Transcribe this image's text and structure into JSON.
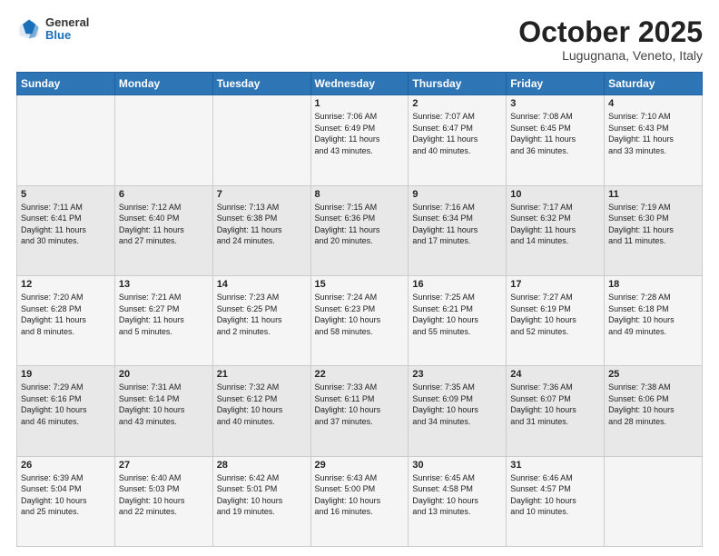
{
  "header": {
    "logo": {
      "general": "General",
      "blue": "Blue"
    },
    "title": "October 2025",
    "subtitle": "Lugugnana, Veneto, Italy"
  },
  "days_of_week": [
    "Sunday",
    "Monday",
    "Tuesday",
    "Wednesday",
    "Thursday",
    "Friday",
    "Saturday"
  ],
  "weeks": [
    [
      {
        "day": "",
        "info": ""
      },
      {
        "day": "",
        "info": ""
      },
      {
        "day": "",
        "info": ""
      },
      {
        "day": "1",
        "info": "Sunrise: 7:06 AM\nSunset: 6:49 PM\nDaylight: 11 hours\nand 43 minutes."
      },
      {
        "day": "2",
        "info": "Sunrise: 7:07 AM\nSunset: 6:47 PM\nDaylight: 11 hours\nand 40 minutes."
      },
      {
        "day": "3",
        "info": "Sunrise: 7:08 AM\nSunset: 6:45 PM\nDaylight: 11 hours\nand 36 minutes."
      },
      {
        "day": "4",
        "info": "Sunrise: 7:10 AM\nSunset: 6:43 PM\nDaylight: 11 hours\nand 33 minutes."
      }
    ],
    [
      {
        "day": "5",
        "info": "Sunrise: 7:11 AM\nSunset: 6:41 PM\nDaylight: 11 hours\nand 30 minutes."
      },
      {
        "day": "6",
        "info": "Sunrise: 7:12 AM\nSunset: 6:40 PM\nDaylight: 11 hours\nand 27 minutes."
      },
      {
        "day": "7",
        "info": "Sunrise: 7:13 AM\nSunset: 6:38 PM\nDaylight: 11 hours\nand 24 minutes."
      },
      {
        "day": "8",
        "info": "Sunrise: 7:15 AM\nSunset: 6:36 PM\nDaylight: 11 hours\nand 20 minutes."
      },
      {
        "day": "9",
        "info": "Sunrise: 7:16 AM\nSunset: 6:34 PM\nDaylight: 11 hours\nand 17 minutes."
      },
      {
        "day": "10",
        "info": "Sunrise: 7:17 AM\nSunset: 6:32 PM\nDaylight: 11 hours\nand 14 minutes."
      },
      {
        "day": "11",
        "info": "Sunrise: 7:19 AM\nSunset: 6:30 PM\nDaylight: 11 hours\nand 11 minutes."
      }
    ],
    [
      {
        "day": "12",
        "info": "Sunrise: 7:20 AM\nSunset: 6:28 PM\nDaylight: 11 hours\nand 8 minutes."
      },
      {
        "day": "13",
        "info": "Sunrise: 7:21 AM\nSunset: 6:27 PM\nDaylight: 11 hours\nand 5 minutes."
      },
      {
        "day": "14",
        "info": "Sunrise: 7:23 AM\nSunset: 6:25 PM\nDaylight: 11 hours\nand 2 minutes."
      },
      {
        "day": "15",
        "info": "Sunrise: 7:24 AM\nSunset: 6:23 PM\nDaylight: 10 hours\nand 58 minutes."
      },
      {
        "day": "16",
        "info": "Sunrise: 7:25 AM\nSunset: 6:21 PM\nDaylight: 10 hours\nand 55 minutes."
      },
      {
        "day": "17",
        "info": "Sunrise: 7:27 AM\nSunset: 6:19 PM\nDaylight: 10 hours\nand 52 minutes."
      },
      {
        "day": "18",
        "info": "Sunrise: 7:28 AM\nSunset: 6:18 PM\nDaylight: 10 hours\nand 49 minutes."
      }
    ],
    [
      {
        "day": "19",
        "info": "Sunrise: 7:29 AM\nSunset: 6:16 PM\nDaylight: 10 hours\nand 46 minutes."
      },
      {
        "day": "20",
        "info": "Sunrise: 7:31 AM\nSunset: 6:14 PM\nDaylight: 10 hours\nand 43 minutes."
      },
      {
        "day": "21",
        "info": "Sunrise: 7:32 AM\nSunset: 6:12 PM\nDaylight: 10 hours\nand 40 minutes."
      },
      {
        "day": "22",
        "info": "Sunrise: 7:33 AM\nSunset: 6:11 PM\nDaylight: 10 hours\nand 37 minutes."
      },
      {
        "day": "23",
        "info": "Sunrise: 7:35 AM\nSunset: 6:09 PM\nDaylight: 10 hours\nand 34 minutes."
      },
      {
        "day": "24",
        "info": "Sunrise: 7:36 AM\nSunset: 6:07 PM\nDaylight: 10 hours\nand 31 minutes."
      },
      {
        "day": "25",
        "info": "Sunrise: 7:38 AM\nSunset: 6:06 PM\nDaylight: 10 hours\nand 28 minutes."
      }
    ],
    [
      {
        "day": "26",
        "info": "Sunrise: 6:39 AM\nSunset: 5:04 PM\nDaylight: 10 hours\nand 25 minutes."
      },
      {
        "day": "27",
        "info": "Sunrise: 6:40 AM\nSunset: 5:03 PM\nDaylight: 10 hours\nand 22 minutes."
      },
      {
        "day": "28",
        "info": "Sunrise: 6:42 AM\nSunset: 5:01 PM\nDaylight: 10 hours\nand 19 minutes."
      },
      {
        "day": "29",
        "info": "Sunrise: 6:43 AM\nSunset: 5:00 PM\nDaylight: 10 hours\nand 16 minutes."
      },
      {
        "day": "30",
        "info": "Sunrise: 6:45 AM\nSunset: 4:58 PM\nDaylight: 10 hours\nand 13 minutes."
      },
      {
        "day": "31",
        "info": "Sunrise: 6:46 AM\nSunset: 4:57 PM\nDaylight: 10 hours\nand 10 minutes."
      },
      {
        "day": "",
        "info": ""
      }
    ]
  ]
}
